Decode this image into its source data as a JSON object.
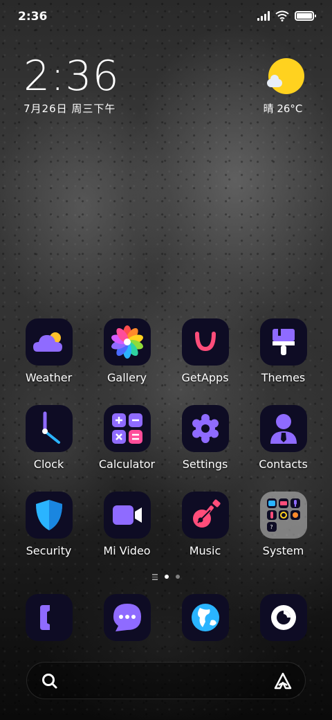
{
  "status_bar": {
    "time": "2:36",
    "icons": [
      "signal-icon",
      "wifi-icon",
      "battery-icon"
    ],
    "battery_level": 1.0
  },
  "clock_widget": {
    "time": "2:36",
    "date": "7月26日 周三下午"
  },
  "weather_widget": {
    "icon": "sun-cloud-icon",
    "text": "晴 26°C"
  },
  "apps": [
    {
      "label": "Weather",
      "icon": "weather-icon"
    },
    {
      "label": "Gallery",
      "icon": "gallery-icon"
    },
    {
      "label": "GetApps",
      "icon": "getapps-icon"
    },
    {
      "label": "Themes",
      "icon": "themes-icon"
    },
    {
      "label": "Clock",
      "icon": "clock-icon"
    },
    {
      "label": "Calculator",
      "icon": "calculator-icon"
    },
    {
      "label": "Settings",
      "icon": "settings-icon"
    },
    {
      "label": "Contacts",
      "icon": "contacts-icon"
    },
    {
      "label": "Security",
      "icon": "security-icon"
    },
    {
      "label": "Mi Video",
      "icon": "video-icon"
    },
    {
      "label": "Music",
      "icon": "music-icon"
    },
    {
      "label": "System",
      "icon": "folder-icon"
    }
  ],
  "page_indicator": {
    "pages": 2,
    "current": 1
  },
  "dock": [
    {
      "icon": "phone-icon"
    },
    {
      "icon": "messages-icon"
    },
    {
      "icon": "browser-icon"
    },
    {
      "icon": "camera-icon"
    }
  ],
  "colors": {
    "icon_bg": "#0e0c24",
    "accent_purple": "#8f6bff",
    "accent_pink": "#ff4d7a",
    "accent_blue": "#2ab4ff",
    "sun_yellow": "#ffd21f"
  }
}
